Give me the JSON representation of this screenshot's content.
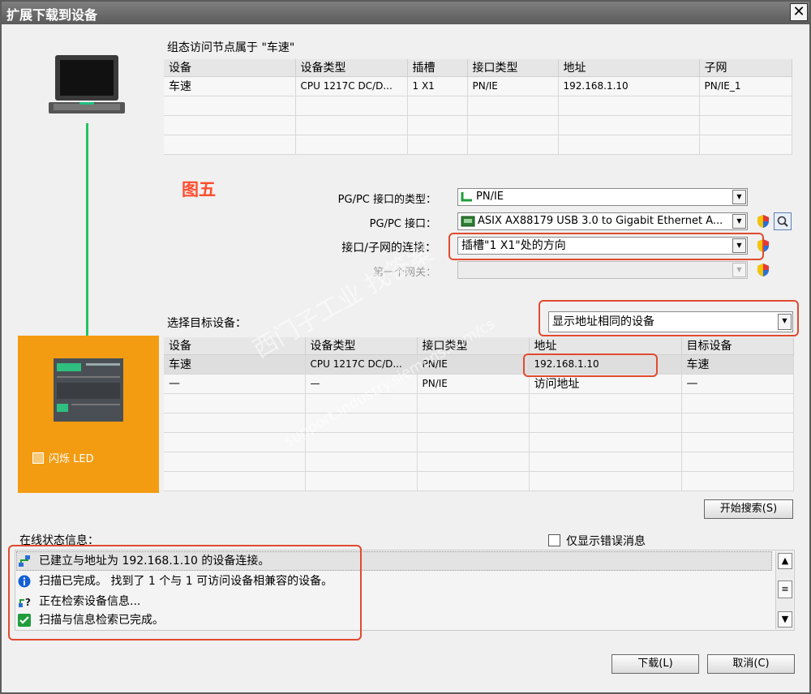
{
  "window": {
    "title": "扩展下载到设备",
    "close_label": "✕"
  },
  "top_section": {
    "heading": "组态访问节点属于 \"车速\"",
    "columns": [
      "设备",
      "设备类型",
      "插槽",
      "接口类型",
      "地址",
      "子网"
    ],
    "rows": [
      [
        "车速",
        "CPU 1217C DC/D...",
        "1 X1",
        "PN/IE",
        "192.168.1.10",
        "PN/IE_1"
      ]
    ]
  },
  "annotation": "图五",
  "settings": {
    "pgpc_type_label": "PG/PC 接口的类型：",
    "pgpc_type_value": "PN/IE",
    "pgpc_iface_label": "PG/PC 接口：",
    "pgpc_iface_value": "ASIX AX88179 USB 3.0 to Gigabit Ethernet A...",
    "conn_label": "接口/子网的连接：",
    "conn_value": "插槽\"1 X1\"处的方向",
    "gateway_label": "第一个网关：",
    "gateway_value": ""
  },
  "target": {
    "label": "选择目标设备：",
    "filter_value": "显示地址相同的设备",
    "columns": [
      "设备",
      "设备类型",
      "接口类型",
      "地址",
      "目标设备"
    ],
    "rows": [
      [
        "车速",
        "CPU 1217C DC/D...",
        "PN/IE",
        "192.168.1.10",
        "车速"
      ],
      [
        "—",
        "—",
        "PN/IE",
        "访问地址",
        "—"
      ]
    ]
  },
  "device_panel": {
    "flash_led_label": "闪烁 LED",
    "accent_color": "#f39c12"
  },
  "search_button": "开始搜索(S)",
  "status": {
    "label": "在线状态信息：",
    "errors_only_label": "仅显示错误消息",
    "messages": [
      {
        "icon": "network-connected-icon",
        "text": "已建立与地址为 192.168.1.10 的设备连接。"
      },
      {
        "icon": "info-icon",
        "text": "扫描已完成。 找到了 1 个与 1 可访问设备相兼容的设备。"
      },
      {
        "icon": "network-query-icon",
        "text": "正在检索设备信息..."
      },
      {
        "icon": "check-icon",
        "text": "扫描与信息检索已完成。"
      }
    ]
  },
  "buttons": {
    "download": "下载(L)",
    "cancel": "取消(C)"
  },
  "watermark": {
    "line1": "西门子工业 找答案",
    "line2": "support.industry.siemens.com/cs"
  },
  "colors": {
    "highlight_red": "#e04b2f",
    "link_green": "#22c55e",
    "annotation_red": "#ff4d2e"
  }
}
